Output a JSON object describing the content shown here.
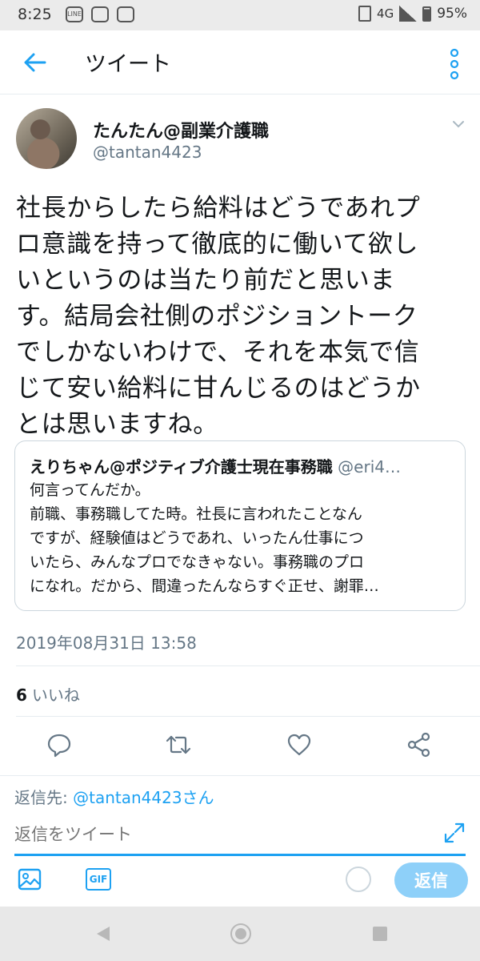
{
  "status_bar": {
    "time": "8:25",
    "network": "4G",
    "battery": "95%",
    "icons": [
      "line-icon",
      "coffee-icon",
      "photo-icon"
    ]
  },
  "header": {
    "title": "ツイート",
    "back_icon": "arrow-left-icon",
    "menu_icon": "more-vertical-icon"
  },
  "tweet": {
    "author_name": "たんたん@副業介護職",
    "author_handle": "@tantan4423",
    "text_lines": [
      "社長からしたら給料はどうであれプ",
      "ロ意識を持って徹底的に働いて欲し",
      "いというのは当たり前だと思いま",
      "す。結局会社側のポジショントーク",
      "でしかないわけで、それを本気で信",
      "じて安い給料に甘んじるのはどうか",
      "とは思いますね。"
    ],
    "quoted": {
      "name": "えりちゃん@ポジティブ介護士現在事務職",
      "handle": "@eri4…",
      "lines": [
        "何言ってんだか。",
        "前職、事務職してた時。社長に言われたことなん",
        "ですが、経験値はどうであれ、いったん仕事につ",
        "いたら、みんなプロでなきゃない。事務職のプロ",
        "になれ。だから、間違ったんならすぐ正せ、謝罪…"
      ]
    },
    "timestamp": "2019年08月31日 13:58",
    "likes_count": "6",
    "likes_label": "いいね"
  },
  "actions": [
    "reply-icon",
    "retweet-icon",
    "like-icon",
    "share-icon"
  ],
  "composer": {
    "reply_to_prefix": "返信先: ",
    "reply_to_handle": "@tantan4423さん",
    "placeholder": "返信をツイート",
    "gif_label": "GIF",
    "reply_button": "返信"
  },
  "colors": {
    "accent": "#1da1f2",
    "secondary_text": "#657786",
    "reply_button_bg": "#8ed0f9"
  }
}
